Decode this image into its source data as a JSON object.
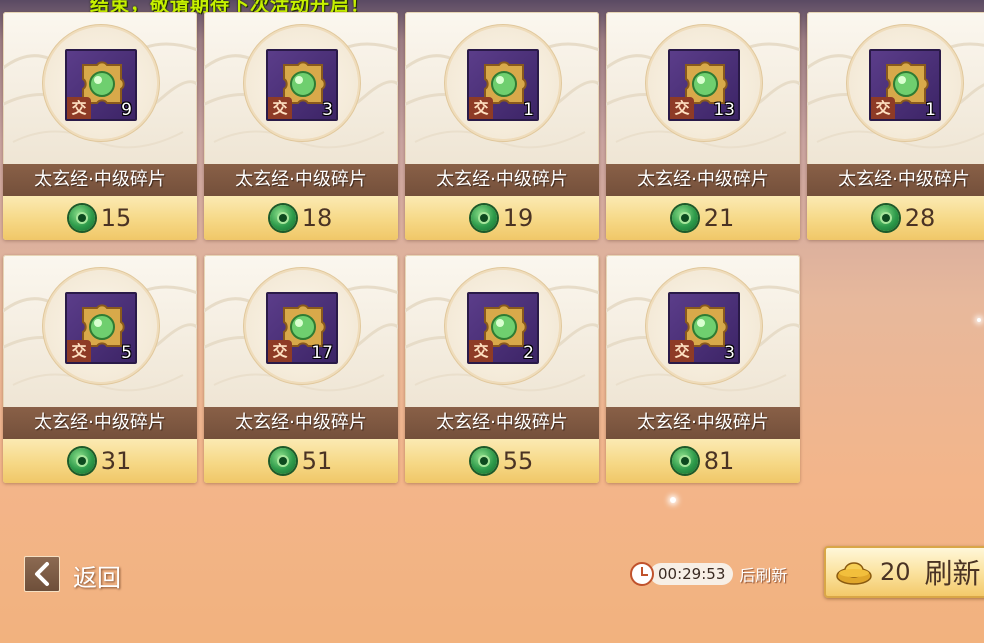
{
  "banner_text": "结束，敬请期待下次活动开启！",
  "items": [
    {
      "name": "太玄经·中级碎片",
      "quantity": "9",
      "price": "15",
      "trade_badge": "交"
    },
    {
      "name": "太玄经·中级碎片",
      "quantity": "3",
      "price": "18",
      "trade_badge": "交"
    },
    {
      "name": "太玄经·中级碎片",
      "quantity": "1",
      "price": "19",
      "trade_badge": "交"
    },
    {
      "name": "太玄经·中级碎片",
      "quantity": "13",
      "price": "21",
      "trade_badge": "交"
    },
    {
      "name": "太玄经·中级碎片",
      "quantity": "1",
      "price": "28",
      "trade_badge": "交"
    },
    {
      "name": "太玄经·中级碎片",
      "quantity": "5",
      "price": "31",
      "trade_badge": "交"
    },
    {
      "name": "太玄经·中级碎片",
      "quantity": "17",
      "price": "51",
      "trade_badge": "交"
    },
    {
      "name": "太玄经·中级碎片",
      "quantity": "2",
      "price": "55",
      "trade_badge": "交"
    },
    {
      "name": "太玄经·中级碎片",
      "quantity": "3",
      "price": "81",
      "trade_badge": "交"
    }
  ],
  "footer": {
    "back_label": "返回",
    "timer_value": "00:29:53",
    "timer_suffix": "后刷新",
    "refresh_cost": "20",
    "refresh_label": "刷新"
  },
  "icons": {
    "item_icon": "puzzle-fragment-icon",
    "price_currency_icon": "jade-coin-icon",
    "refresh_currency_icon": "gold-ingot-icon",
    "timer_icon": "clock-icon",
    "back_icon": "chevron-left-icon"
  },
  "colors": {
    "banner": "#c6f000",
    "name_bar": "#7b5540",
    "price_bar": "#f6d886",
    "item_icon_bg": "#4a2f78"
  }
}
